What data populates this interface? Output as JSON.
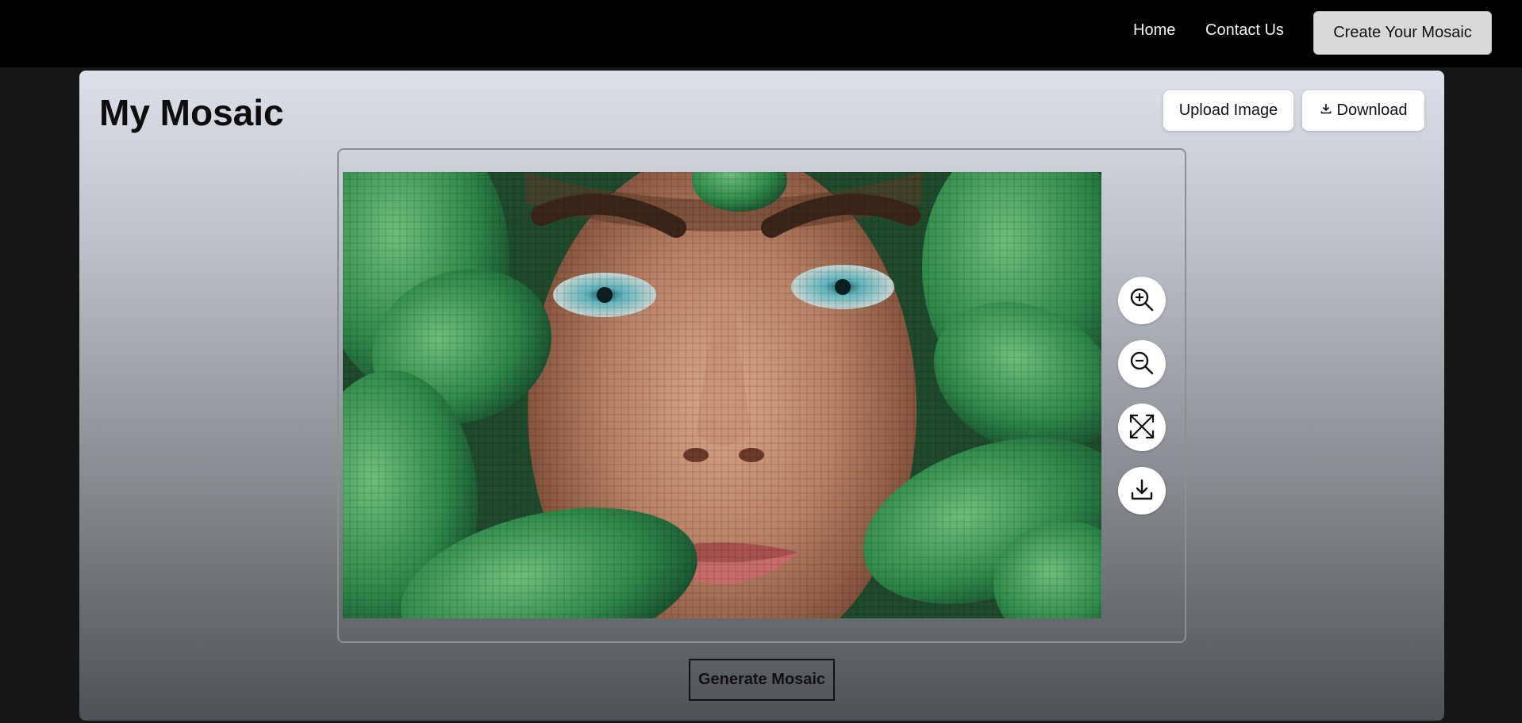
{
  "nav": {
    "home_label": "Home",
    "contact_label": "Contact Us",
    "cta_label": "Create Your Mosaic"
  },
  "page": {
    "title": "My Mosaic",
    "upload_label": "Upload Image",
    "download_label": "Download",
    "generate_label": "Generate Mosaic"
  },
  "tools": {
    "zoom_in_icon": "zoom-in-icon",
    "zoom_out_icon": "zoom-out-icon",
    "fullscreen_icon": "expand-arrows-icon",
    "download_icon": "download-tray-icon"
  },
  "colors": {
    "topbar": "#000000",
    "cta_background": "#d9d9d9",
    "panel_top": "#dde0e9",
    "panel_bottom": "#4e5155",
    "button_background": "#ffffff"
  }
}
